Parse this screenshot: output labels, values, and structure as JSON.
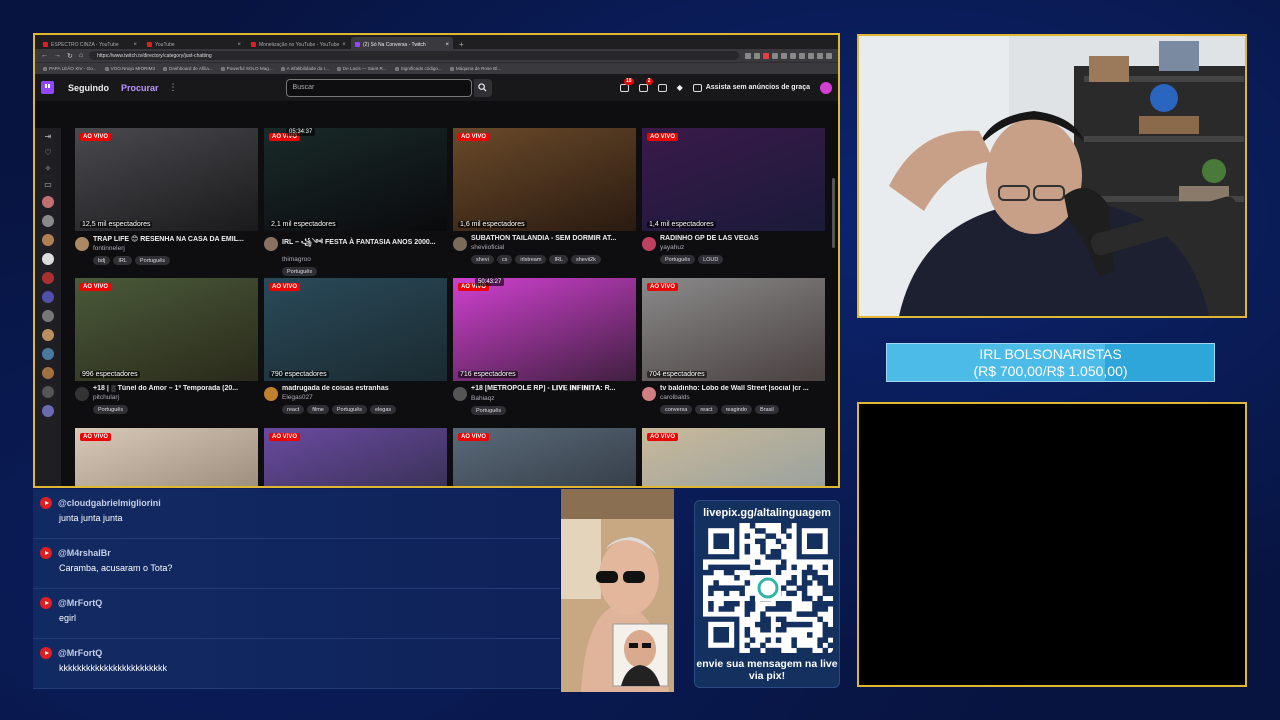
{
  "browser": {
    "tabs": [
      {
        "label": "ESPECTRO CINZA - YouTube",
        "active": false
      },
      {
        "label": "YouTube",
        "active": false
      },
      {
        "label": "Monetização no YouTube - YouTube",
        "active": false
      },
      {
        "label": "(2) Só Na Conversa - Twitch",
        "active": true
      }
    ],
    "url": "https://www.twitch.tv/directory/category/just-chatting",
    "bookmarks": [
      "PAPA LEÃO XIV - Go...",
      "VOO.Nnojo MIORIM3",
      "Dashboard de Afilia...",
      "Powerful SOLO Mag...",
      "A infalibilidade da I...",
      "De Lacis — Saint R...",
      "Significado código...",
      "Máquina de Rose Bl..."
    ]
  },
  "twitch": {
    "nav_following": "Seguindo",
    "nav_browse": "Procurar",
    "search_placeholder": "Buscar",
    "notif_count": "18",
    "inbox_count": "2",
    "promo": "Assista sem anúncios de graça",
    "live_label": "AO VIVO",
    "streams": [
      {
        "title": "TRAP LIFE 😊 RESENHA NA CASA DA EMIL...",
        "user": "fontinnelerj",
        "viewers": "12,5 mil espectadores",
        "tags": [
          "bdj",
          "IRL",
          "Português"
        ],
        "timer": "",
        "c1": "#4a4a4e",
        "c2": "#1a1a1c",
        "av": "#aa8866"
      },
      {
        "title": "IRL – ꧁༺ FESTA À FANTASIA ANOS 2000...",
        "user": "thimagroo",
        "viewers": "2,1 mil espectadores",
        "tags": [
          "Português"
        ],
        "timer": "05:34:37",
        "c1": "#1a2a2a",
        "c2": "#0a0a0c",
        "av": "#8a7060"
      },
      {
        "title": "SUBATHON TAILANDIA - SEM DORMIR AT...",
        "user": "sheviioficial",
        "viewers": "1,6 mil espectadores",
        "tags": [
          "shevi",
          "cs",
          "irlstream",
          "IRL",
          "shevii2k"
        ],
        "timer": "",
        "c1": "#6a4a2a",
        "c2": "#2a1a10",
        "av": "#7a6a5a"
      },
      {
        "title": "RADINHO GP DE LAS VEGAS",
        "user": "yayahuz",
        "viewers": "1,4 mil espectadores",
        "tags": [
          "Português",
          "LOUD"
        ],
        "timer": "",
        "c1": "#3a1a4a",
        "c2": "#1a1a3a",
        "av": "#c04060"
      },
      {
        "title": "+18 | ░ Túnel do Amor – 1ª Temporada (20...",
        "user": "pitchularj",
        "viewers": "996 espectadores",
        "tags": [
          "Português"
        ],
        "timer": "",
        "c1": "#4a5a3a",
        "c2": "#2a2a1a",
        "av": "#333"
      },
      {
        "title": "madrugada de coisas estranhas",
        "user": "Elegas027",
        "viewers": "790 espectadores",
        "tags": [
          "react",
          "filme",
          "Português",
          "elegas"
        ],
        "timer": "",
        "c1": "#2a4a5a",
        "c2": "#1a2a30",
        "av": "#c08030"
      },
      {
        "title": "+18 [METRÓPOLE RP] - 𝐋𝐈𝐕𝐄 𝐈𝐍𝐅𝐈𝐍𝐈𝐓𝐀: R...",
        "user": "Bahiaqz",
        "viewers": "716 espectadores",
        "tags": [
          "Português"
        ],
        "timer": "50:43:27",
        "c1": "#d040d0",
        "c2": "#402040",
        "av": "#555"
      },
      {
        "title": "tv baldinho: Lobo de Wall Street |social |cr ...",
        "user": "carolbalds",
        "viewers": "704 espectadores",
        "tags": [
          "conversa",
          "react",
          "reagindo",
          "Brasil"
        ],
        "timer": "",
        "c1": "#8a8a8a",
        "c2": "#4a4040",
        "av": "#d08080"
      },
      {
        "title": "",
        "user": "",
        "viewers": "",
        "tags": [],
        "timer": "",
        "c1": "#d9c9b9",
        "c2": "#8a7a6a",
        "av": "#555"
      },
      {
        "title": "",
        "user": "",
        "viewers": "",
        "tags": [],
        "timer": "",
        "c1": "#6a4aa0",
        "c2": "#2a2a40",
        "av": "#555"
      },
      {
        "title": "",
        "user": "",
        "viewers": "",
        "tags": [],
        "timer": "",
        "c1": "#5a6a7a",
        "c2": "#2a3038",
        "av": "#555"
      },
      {
        "title": "",
        "user": "",
        "viewers": "",
        "tags": [],
        "timer": "",
        "c1": "#c9b99a",
        "c2": "#8a9aa0",
        "av": "#555"
      }
    ]
  },
  "goal": {
    "title": "IRL BOLSONARISTAS",
    "amount": "(R$ 700,00/R$ 1.050,00)",
    "progress": 0.667
  },
  "chat": [
    {
      "user": "@cloudgabrielmigliorini",
      "text": "junta junta junta"
    },
    {
      "user": "@M4rshalBr",
      "text": "Caramba, acusaram o Tota?"
    },
    {
      "user": "@MrFortQ",
      "text": "egirl"
    },
    {
      "user": "@MrFortQ",
      "text": "kkkkkkkkkkkkkkkkkkkkkkkk"
    }
  ],
  "pix": {
    "url": "livepix.gg/altalinguagem",
    "message": "envie sua mensagem na live via pix!"
  }
}
